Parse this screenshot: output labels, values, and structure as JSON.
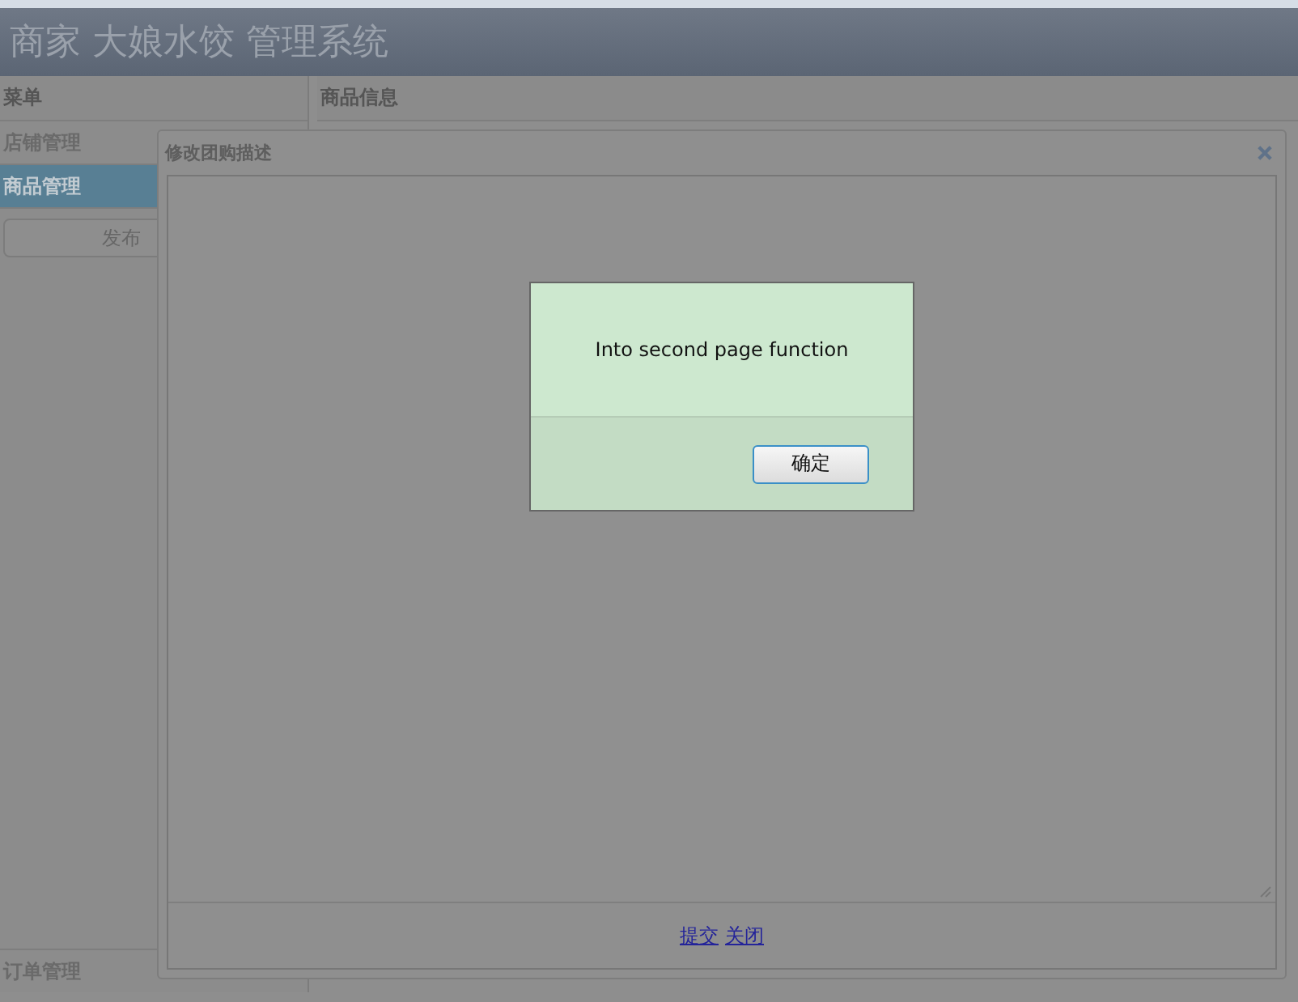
{
  "header": {
    "title": "商家 大娘水饺 管理系统"
  },
  "menu": {
    "title": "菜单",
    "items": [
      {
        "label": "店铺管理",
        "selected": false
      },
      {
        "label": "商品管理",
        "selected": true
      }
    ],
    "button": "发布",
    "bottom_item": "订单管理"
  },
  "main": {
    "title": "商品信息"
  },
  "dialog": {
    "title": "修改团购描述",
    "links": [
      "提交",
      "关闭"
    ]
  },
  "alert": {
    "message": "Into second page function",
    "button": "确定"
  }
}
